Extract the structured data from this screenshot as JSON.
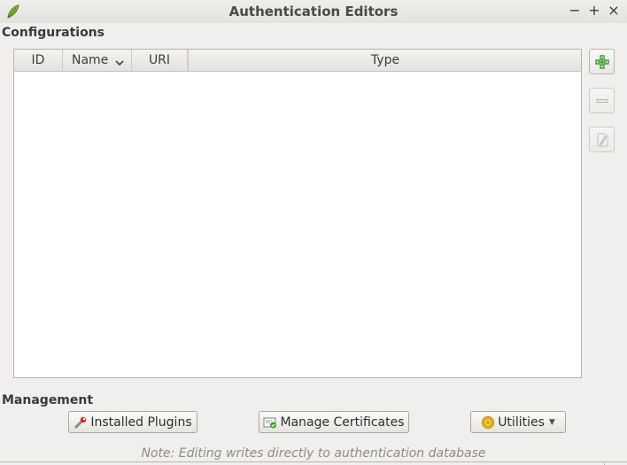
{
  "window": {
    "title": "Authentication Editors",
    "minimize_glyph": "−",
    "maximize_glyph": "+",
    "close_glyph": "×",
    "icon": "qgis-leaf-icon"
  },
  "configurations": {
    "label": "Configurations",
    "columns": [
      "ID",
      "Name",
      "URI",
      "Type"
    ],
    "sorted_column": "Name",
    "sort_direction": "descending",
    "rows": []
  },
  "side_buttons": {
    "add": {
      "icon": "add-icon",
      "enabled": true
    },
    "remove": {
      "icon": "remove-icon",
      "enabled": false
    },
    "edit": {
      "icon": "edit-icon",
      "enabled": false
    }
  },
  "management": {
    "label": "Management",
    "installed_plugins_label": "Installed Plugins",
    "manage_certificates_label": "Manage Certificates",
    "utilities_label": "Utilities"
  },
  "note": "Note: Editing writes directly to authentication database",
  "colors": {
    "add_green": "#3c9a2c",
    "utilities_gold": "#e8b71a"
  }
}
